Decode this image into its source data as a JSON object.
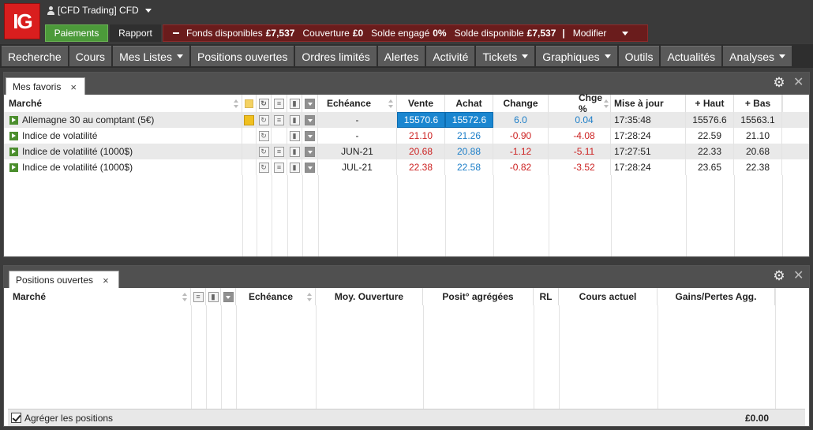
{
  "header": {
    "logo_text": "IG",
    "account_label": "[CFD Trading] CFD",
    "payments_label": "Paiements",
    "report_label": "Rapport",
    "funds": {
      "available_label": "Fonds disponibles",
      "available_value": "£7,537",
      "margin_label": "Couverture",
      "margin_value": "£0",
      "committed_label": "Solde engagé",
      "committed_value": "0%",
      "balance_label": "Solde disponible",
      "balance_value": "£7,537",
      "separator": "|",
      "modify_label": "Modifier"
    }
  },
  "nav": {
    "items": [
      {
        "label": "Recherche",
        "dropdown": false
      },
      {
        "label": "Cours",
        "dropdown": false
      },
      {
        "label": "Mes Listes",
        "dropdown": true
      },
      {
        "label": "Positions ouvertes",
        "dropdown": false
      },
      {
        "label": "Ordres limités",
        "dropdown": false
      },
      {
        "label": "Alertes",
        "dropdown": false
      },
      {
        "label": "Activité",
        "dropdown": false
      },
      {
        "label": "Tickets",
        "dropdown": true
      },
      {
        "label": "Graphiques",
        "dropdown": true
      },
      {
        "label": "Outils",
        "dropdown": false
      },
      {
        "label": "Actualités",
        "dropdown": false
      },
      {
        "label": "Analyses",
        "dropdown": true
      }
    ]
  },
  "favorites": {
    "tab_label": "Mes favoris",
    "close_glyph": "×",
    "columns": {
      "market": "Marché",
      "expiry": "Echéance",
      "sell": "Vente",
      "buy": "Achat",
      "change": "Change",
      "change_pct": "Chge %",
      "updated": "Mise à jour",
      "high": "+ Haut",
      "low": "+ Bas"
    },
    "rows": [
      {
        "market": "Allemagne 30 au comptant (5€)",
        "expiry": "-",
        "sell": "15570.6",
        "buy": "15572.6",
        "change": "6.0",
        "change_pct": "0.04",
        "updated": "17:35:48",
        "high": "15576.6",
        "low": "15563.1",
        "direction": "up",
        "has_bulb": true,
        "has_list": true
      },
      {
        "market": "Indice de volatilité",
        "expiry": "-",
        "sell": "21.10",
        "buy": "21.26",
        "change": "-0.90",
        "change_pct": "-4.08",
        "updated": "17:28:24",
        "high": "22.59",
        "low": "21.10",
        "direction": "down",
        "has_bulb": false,
        "has_list": false
      },
      {
        "market": "Indice de volatilité (1000$)",
        "expiry": "JUN-21",
        "sell": "20.68",
        "buy": "20.88",
        "change": "-1.12",
        "change_pct": "-5.11",
        "updated": "17:27:51",
        "high": "22.33",
        "low": "20.68",
        "direction": "down",
        "has_bulb": false,
        "has_list": true
      },
      {
        "market": "Indice de volatilité (1000$)",
        "expiry": "JUL-21",
        "sell": "22.38",
        "buy": "22.58",
        "change": "-0.82",
        "change_pct": "-3.52",
        "updated": "17:28:24",
        "high": "23.65",
        "low": "22.38",
        "direction": "down",
        "has_bulb": false,
        "has_list": true
      }
    ]
  },
  "positions": {
    "tab_label": "Positions ouvertes",
    "close_glyph": "×",
    "columns": {
      "market": "Marché",
      "expiry": "Echéance",
      "avg_open": "Moy. Ouverture",
      "aggregated": "Posit° agrégées",
      "rl": "RL",
      "current": "Cours actuel",
      "pl": "Gains/Pertes Agg."
    },
    "aggregate_label": "Agréger les positions",
    "total": "£0.00"
  },
  "colors": {
    "logo_red": "#d91e1e",
    "payments_green": "#4c9a3a",
    "funds_bar": "#6a1c1c",
    "selected_blue": "#1a86d0",
    "negative": "#cc2222",
    "positive": "#1c7ec8"
  }
}
